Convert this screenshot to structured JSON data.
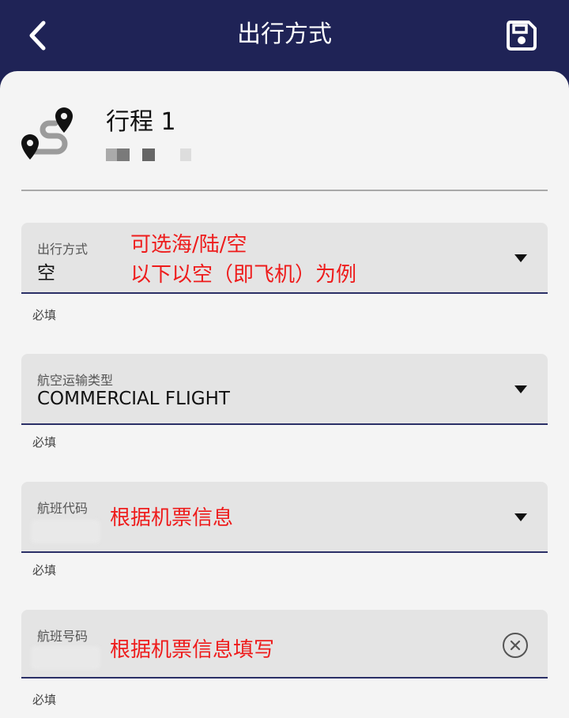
{
  "header": {
    "title": "出行方式",
    "back_icon": "chevron-left-icon",
    "save_icon": "floppy-disk-icon",
    "background_color": "#1f2356"
  },
  "trip": {
    "title": "行程 1",
    "icon": "route-pins-icon"
  },
  "fields": [
    {
      "label": "出行方式",
      "value": "空",
      "helper": "必填",
      "control": "dropdown",
      "annotation_lines": [
        "可选海/陆/空",
        "以下以空（即飞机）为例"
      ]
    },
    {
      "label": "航空运输类型",
      "value": "COMMERCIAL FLIGHT",
      "helper": "必填",
      "control": "dropdown"
    },
    {
      "label": "航班代码",
      "value": "",
      "helper": "必填",
      "control": "dropdown",
      "annotation_lines": [
        "根据机票信息"
      ]
    },
    {
      "label": "航班号码",
      "value": "",
      "helper": "必填",
      "control": "clear-button",
      "annotation_lines": [
        "根据机票信息填写"
      ]
    }
  ],
  "colors": {
    "accent_underline": "#2a2f66",
    "field_background": "#e4e4e4",
    "annotation": "#ee1c1c",
    "page_background": "#f4f4f4"
  }
}
